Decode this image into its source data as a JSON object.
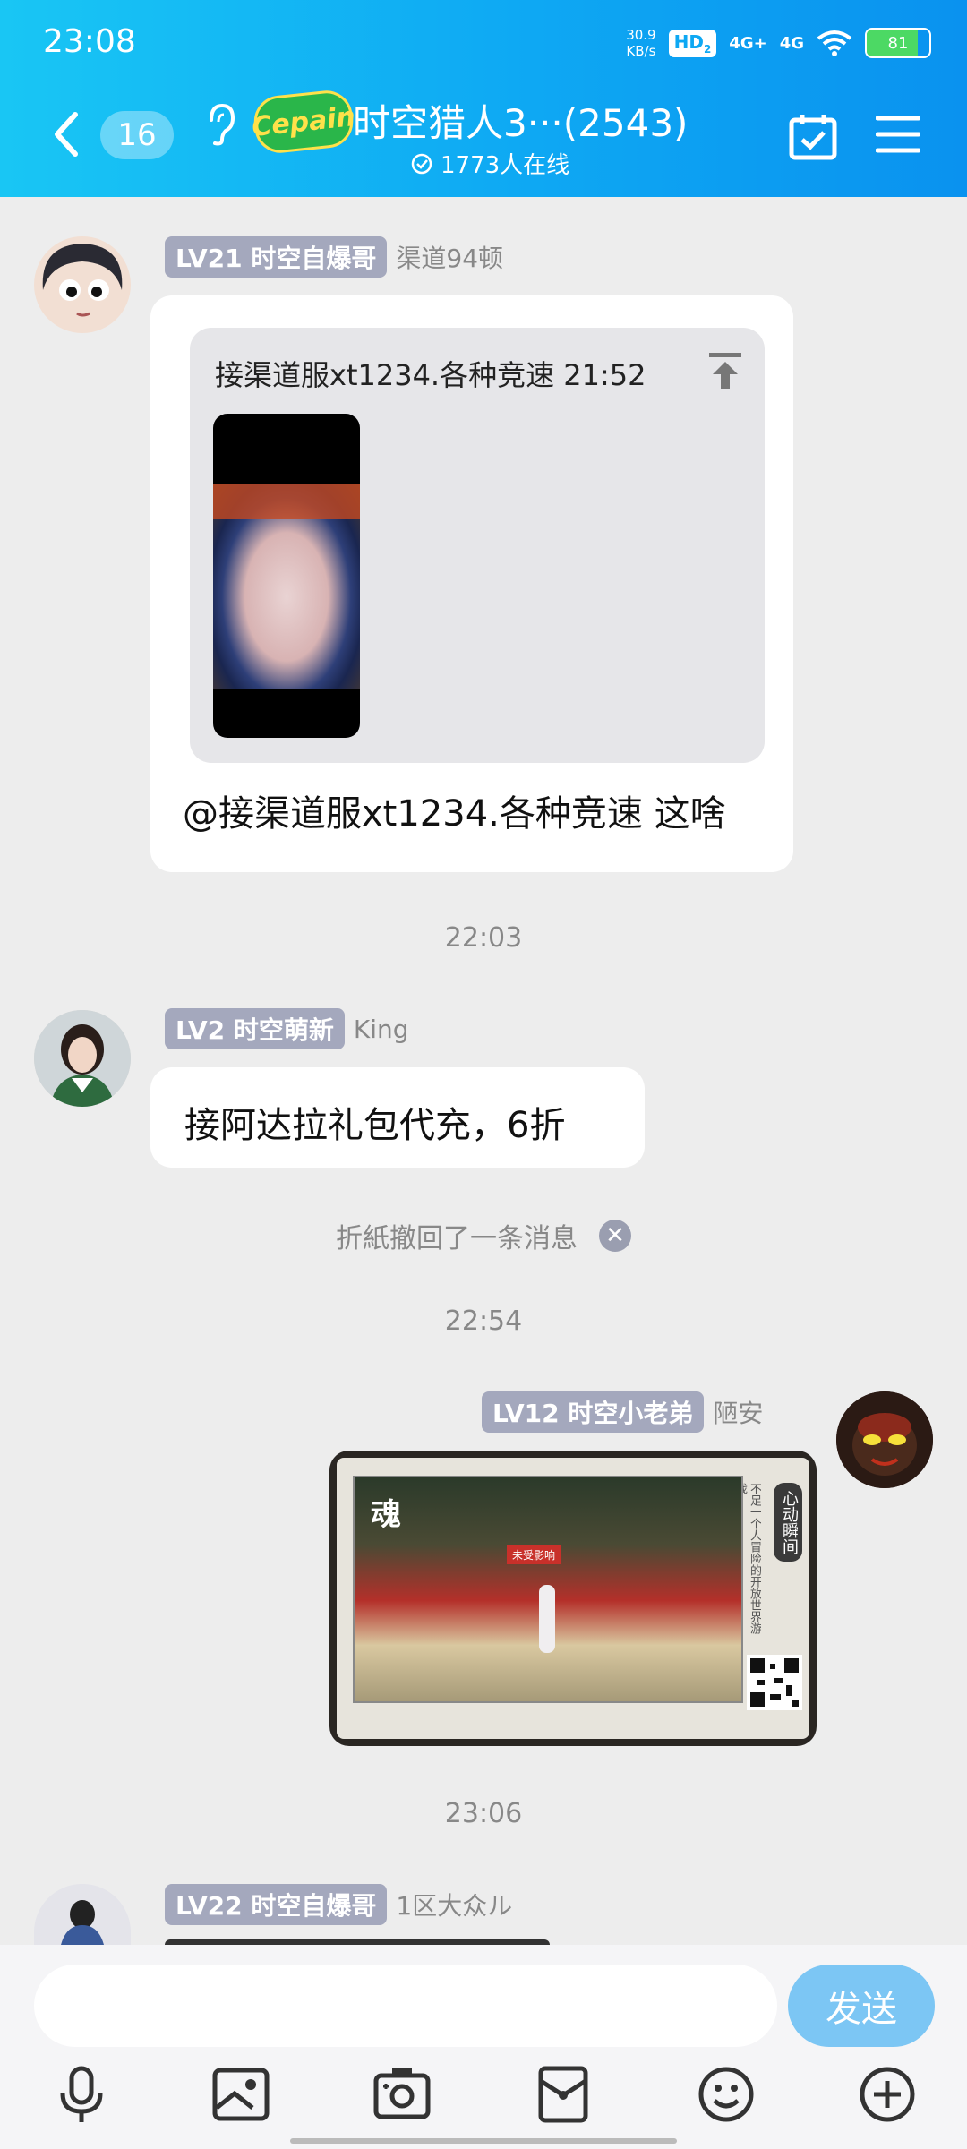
{
  "status_bar": {
    "time": "23:08",
    "net_speed_value": "30.9",
    "net_speed_unit": "KB/s",
    "hd": "HD",
    "hd_sub": "2",
    "signal1": "4G+",
    "signal2": "4G",
    "battery": "81",
    "battery_level": 0.81
  },
  "header": {
    "unread_count": "16",
    "logo_text": "Cepain",
    "title": "时空猎人3···(2543)",
    "online_text": "1773人在线"
  },
  "messages": {
    "m1": {
      "level": "LV21 时空自爆哥",
      "nickname": "渠道94顿",
      "quote_text": "接渠道服xt1234.各种竞速 21:52",
      "text": "@接渠道服xt1234.各种竞速 这啥"
    },
    "time1": "22:03",
    "m2": {
      "level": "LV2 时空萌新",
      "nickname": "King",
      "text": "接阿达拉礼包代充，6折"
    },
    "system": "折紙撤回了一条消息",
    "time2": "22:54",
    "m3": {
      "level": "LV12 时空小老弟",
      "nickname": "陋安",
      "card_logo_text": "魂",
      "card_side_text": "心动瞬间",
      "card_small_text": "不足一个人冒险的开放世界游戏",
      "card_tag": "未受影响"
    },
    "time3": "23:06",
    "m4": {
      "level": "LV22 时空自爆哥",
      "nickname": "1区大众ル"
    }
  },
  "input_bar": {
    "placeholder": "",
    "send_label": "发送"
  },
  "colors": {
    "header_start": "#19c6f4",
    "header_end": "#0a92ef",
    "level_badge": "#a4a8bd",
    "send_button": "#7cc6f4"
  }
}
